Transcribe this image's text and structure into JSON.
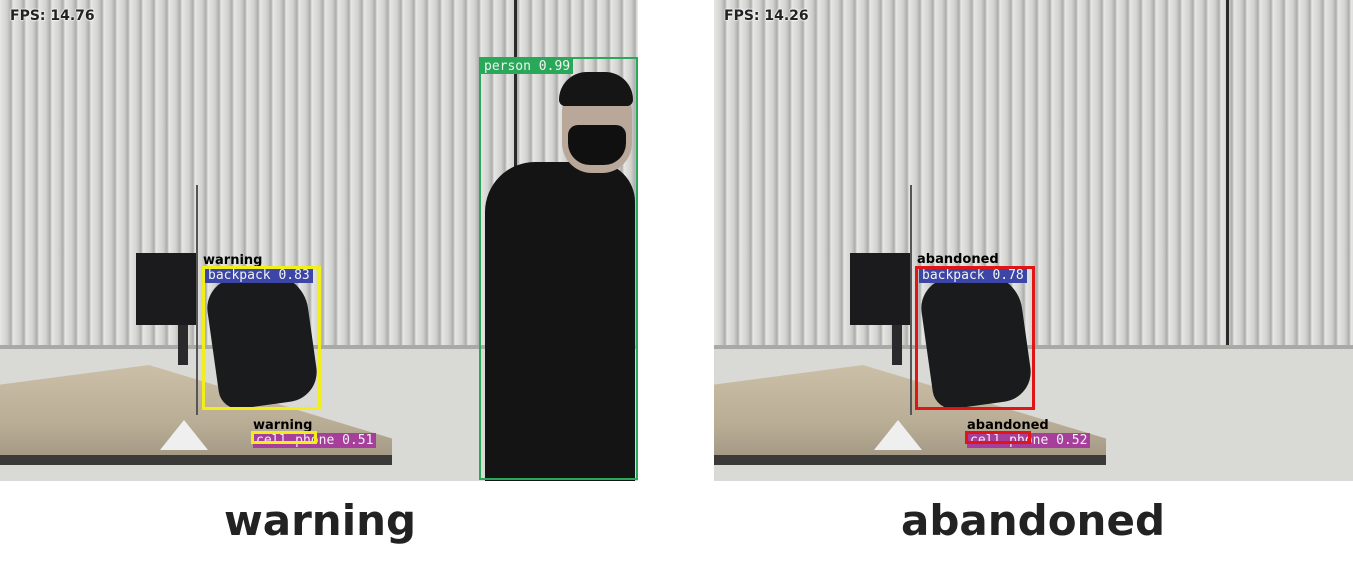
{
  "panels": [
    {
      "fps": "FPS: 14.76",
      "caption": "warning",
      "state_text": "warning",
      "detections": [
        {
          "label": "person 0.99",
          "class": "person",
          "color": "#2aa85a"
        },
        {
          "label": "backpack 0.83",
          "class": "backpack",
          "color": "#3b46a6"
        },
        {
          "label": "cell phone 0.51",
          "class": "cell phone",
          "color": "#a63e9c"
        }
      ],
      "state_color": "#f2ee1a"
    },
    {
      "fps": "FPS: 14.26",
      "caption": "abandoned",
      "state_text": "abandoned",
      "detections": [
        {
          "label": "backpack 0.78",
          "class": "backpack",
          "color": "#3b46a6"
        },
        {
          "label": "cell phone 0.52",
          "class": "cell phone",
          "color": "#a63e9c"
        }
      ],
      "state_color": "#e01515"
    }
  ]
}
